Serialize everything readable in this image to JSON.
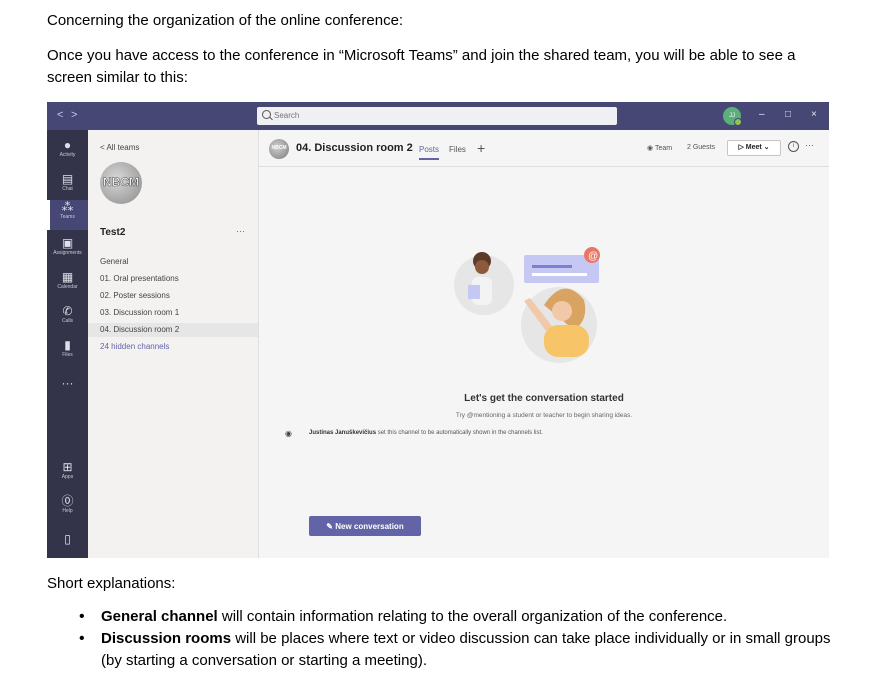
{
  "document": {
    "intro": "Concerning the organization of the online conference:",
    "paragraph": "Once you have access to the conference in “Microsoft Teams” and join the shared team, you will be able to see a screen similar to this:",
    "short_explanations": "Short explanations:",
    "bullets": [
      {
        "term": "General channel",
        "text": " will contain information relating to the overall organization of the conference."
      },
      {
        "term": "Discussion rooms",
        "text": " will be places where text or video discussion can take place individually or in small groups (by starting a conversation or starting a meeting)."
      }
    ]
  },
  "teams": {
    "titlebar": {
      "back": "<",
      "forward": ">",
      "search_placeholder": "Search",
      "avatar_initials": "JJ",
      "minimize": "–",
      "maximize": "□",
      "close": "×"
    },
    "rail": [
      {
        "label": "Activity",
        "icon": "bell-icon",
        "glyph": "🔔"
      },
      {
        "label": "Chat",
        "icon": "chat-icon",
        "glyph": "▤"
      },
      {
        "label": "Teams",
        "icon": "teams-icon",
        "glyph": "⁂"
      },
      {
        "label": "Assignments",
        "icon": "assignments-icon",
        "glyph": "▣"
      },
      {
        "label": "Calendar",
        "icon": "calendar-icon",
        "glyph": "▦"
      },
      {
        "label": "Calls",
        "icon": "phone-icon",
        "glyph": "✆"
      },
      {
        "label": "Files",
        "icon": "files-icon",
        "glyph": "▮"
      },
      {
        "label": "",
        "icon": "more-icon",
        "glyph": "···"
      },
      {
        "label": "Apps",
        "icon": "apps-icon",
        "glyph": "⊞"
      },
      {
        "label": "Help",
        "icon": "help-icon",
        "glyph": "?"
      },
      {
        "label": "",
        "icon": "device-icon",
        "glyph": "▯"
      }
    ],
    "panel": {
      "all_teams": "< All teams",
      "team_logo": "NBCM",
      "team_name": "Test2",
      "more": "···",
      "channels": [
        "General",
        "01. Oral presentations",
        "02. Poster sessions",
        "03. Discussion room 1",
        "04. Discussion room 2",
        "24 hidden channels"
      ]
    },
    "header": {
      "channel_avatar": "NBCM",
      "channel_title": "04. Discussion room 2",
      "tab_posts": "Posts",
      "tab_files": "Files",
      "tab_add": "+",
      "team": "Team",
      "guests": "2 Guests",
      "meet": "Meet",
      "more": "···"
    },
    "conversation": {
      "title": "Let's get the conversation started",
      "subtitle": "Try @mentioning a student or teacher to begin sharing ideas.",
      "notice_name": "Justinas Januškevičius",
      "notice_text": " set this channel to be automatically shown in the channels list.",
      "new_conversation": "New conversation"
    }
  }
}
